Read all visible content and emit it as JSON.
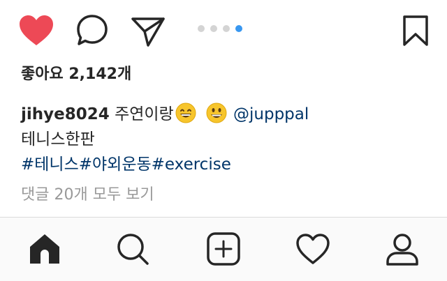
{
  "actions": {
    "like_icon": "heart-filled-icon",
    "comment_icon": "comment-icon",
    "share_icon": "paper-plane-icon",
    "save_icon": "bookmark-icon",
    "carousel_total": 4,
    "carousel_active": 4,
    "accent_like": "#ed4956",
    "accent_carousel": "#3897f0"
  },
  "post": {
    "likes_text": "좋아요 2,142개",
    "username": "jihye8024",
    "caption_text": "주연이랑",
    "mention": "@jupppal",
    "caption_line2": "테니스한판",
    "hashtags": "#테니스#야외운동#exercise",
    "view_comments": "댓글 20개 모두 보기"
  },
  "tabbar": {
    "items": [
      "home-icon",
      "search-icon",
      "add-post-icon",
      "activity-heart-icon",
      "profile-icon"
    ],
    "active": "home-icon"
  }
}
